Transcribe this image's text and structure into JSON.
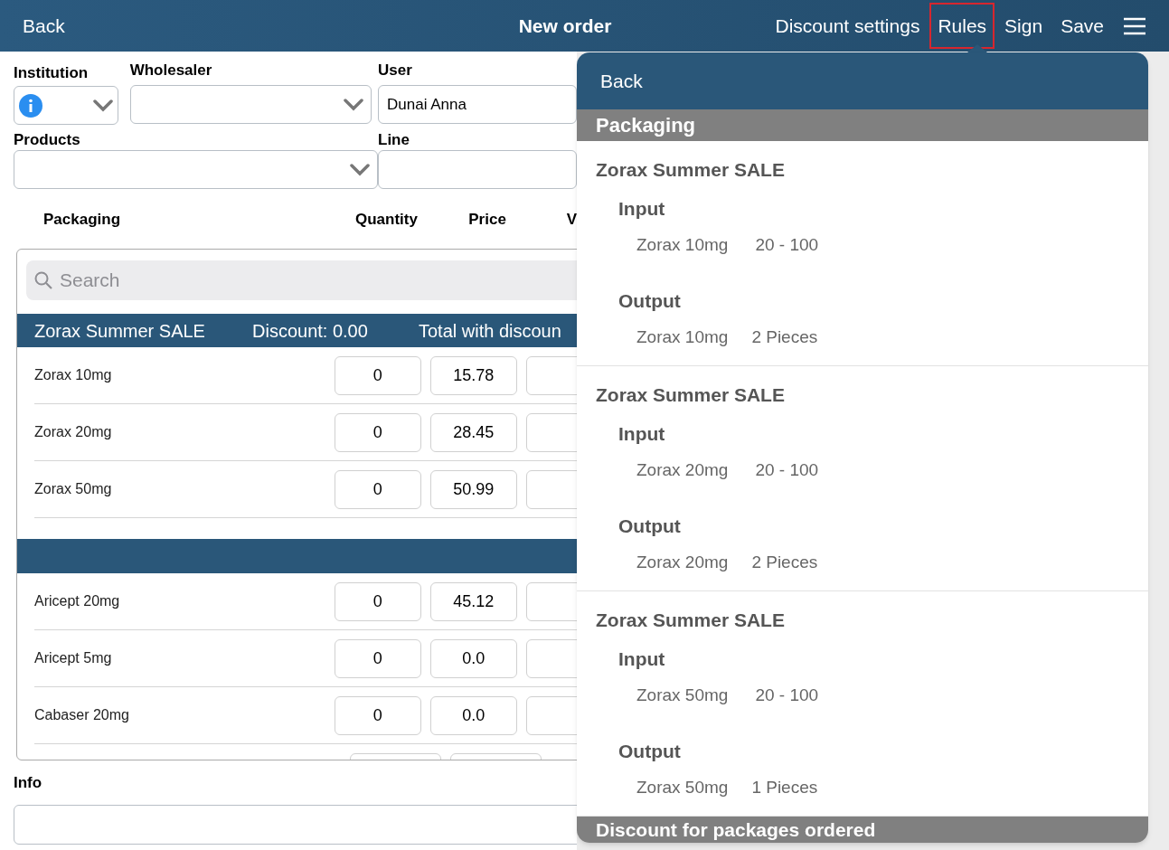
{
  "nav": {
    "back": "Back",
    "title": "New order",
    "items": [
      {
        "label": "Discount settings",
        "selected": false
      },
      {
        "label": "Rules",
        "selected": true
      },
      {
        "label": "Sign",
        "selected": false
      },
      {
        "label": "Save",
        "selected": false
      }
    ]
  },
  "form": {
    "institution": {
      "label": "Institution"
    },
    "wholesaler": {
      "label": "Wholesaler"
    },
    "user": {
      "label": "User",
      "value": "Dunai Anna"
    },
    "products": {
      "label": "Products"
    },
    "line": {
      "label": "Line"
    }
  },
  "columns": [
    "Packaging",
    "Quantity",
    "Price",
    "V"
  ],
  "search": {
    "placeholder": "Search"
  },
  "groups": [
    {
      "title": "Zorax Summer SALE",
      "discount": "Discount: 0.00",
      "total": "Total with discoun",
      "rows": [
        {
          "name": "Zorax 10mg",
          "quantity": "0",
          "price": "15.78"
        },
        {
          "name": "Zorax 20mg",
          "quantity": "0",
          "price": "28.45"
        },
        {
          "name": "Zorax 50mg",
          "quantity": "0",
          "price": "50.99"
        }
      ]
    },
    {
      "rows": [
        {
          "name": "Aricept 20mg",
          "quantity": "0",
          "price": "45.12"
        },
        {
          "name": "Aricept 5mg",
          "quantity": "0",
          "price": "0.0"
        },
        {
          "name": "Cabaser 20mg",
          "quantity": "0",
          "price": "0.0"
        }
      ]
    }
  ],
  "info": {
    "label": "Info"
  },
  "popover": {
    "back": "Back",
    "section": "Packaging",
    "rules": [
      {
        "title": "Zorax Summer SALE",
        "input_label": "Input",
        "input_product": "Zorax 10mg",
        "input_range": "20 - 100",
        "output_label": "Output",
        "output_product": "Zorax 10mg",
        "output_amount": "2 Pieces"
      },
      {
        "title": "Zorax Summer SALE",
        "input_label": "Input",
        "input_product": "Zorax 20mg",
        "input_range": "20 - 100",
        "output_label": "Output",
        "output_product": "Zorax 20mg",
        "output_amount": "2 Pieces"
      },
      {
        "title": "Zorax Summer SALE",
        "input_label": "Input",
        "input_product": "Zorax 50mg",
        "input_range": "20 - 100",
        "output_label": "Output",
        "output_product": "Zorax 50mg",
        "output_amount": "1 Pieces"
      }
    ],
    "footer_section": "Discount for packages ordered"
  }
}
